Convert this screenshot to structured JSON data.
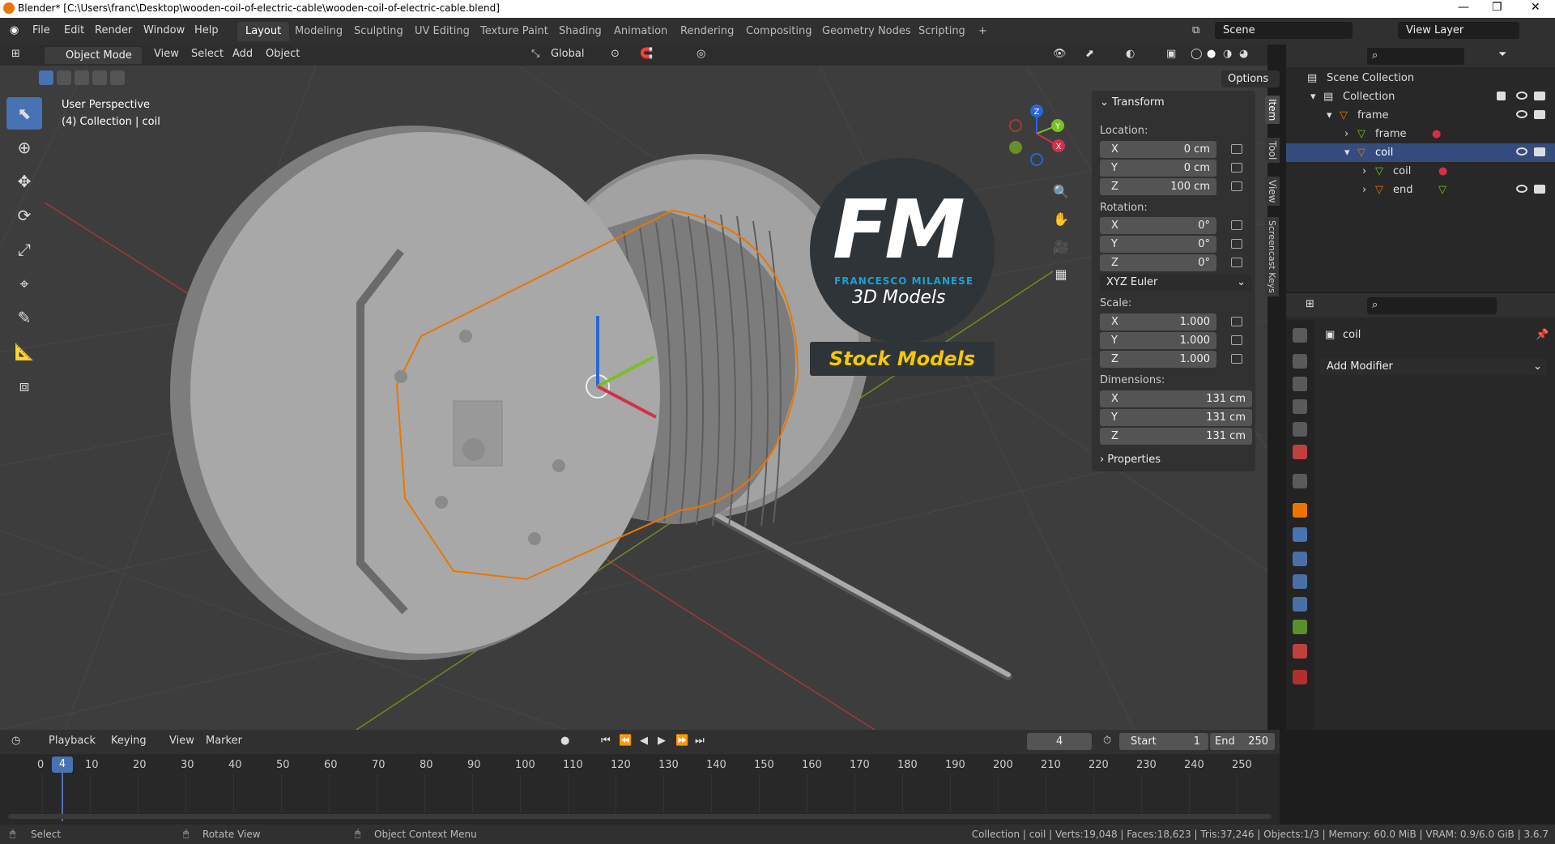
{
  "titlebar": {
    "title": "Blender* [C:\\Users\\franc\\Desktop\\wooden-coil-of-electric-cable\\wooden-coil-of-electric-cable.blend]"
  },
  "menu": {
    "file": "File",
    "edit": "Edit",
    "render": "Render",
    "window": "Window",
    "help": "Help"
  },
  "workspaces": [
    "Layout",
    "Modeling",
    "Sculpting",
    "UV Editing",
    "Texture Paint",
    "Shading",
    "Animation",
    "Rendering",
    "Compositing",
    "Geometry Nodes",
    "Scripting"
  ],
  "active_workspace": "Layout",
  "scene": {
    "label": "Scene",
    "view_layer": "View Layer"
  },
  "viewport": {
    "mode": "Object Mode",
    "menus": [
      "View",
      "Select",
      "Add",
      "Object"
    ],
    "orientation": "Global",
    "options": "Options",
    "perspective": "User Perspective",
    "collection_info": "(4) Collection | coil"
  },
  "logo": {
    "letters": "FM",
    "name": "FRANCESCO MILANESE",
    "tagline": "3D Models",
    "banner": "Stock Models"
  },
  "transform": {
    "header": "Transform",
    "location_label": "Location:",
    "location": {
      "x": "0 cm",
      "y": "0 cm",
      "z": "100 cm"
    },
    "rotation_label": "Rotation:",
    "rotation": {
      "x": "0°",
      "y": "0°",
      "z": "0°"
    },
    "rotation_mode": "XYZ Euler",
    "scale_label": "Scale:",
    "scale": {
      "x": "1.000",
      "y": "1.000",
      "z": "1.000"
    },
    "dimensions_label": "Dimensions:",
    "dimensions": {
      "x": "131 cm",
      "y": "131 cm",
      "z": "131 cm"
    },
    "properties": "Properties",
    "axis": {
      "x": "X",
      "y": "Y",
      "z": "Z"
    }
  },
  "npanel_tabs": [
    "Item",
    "Tool",
    "View",
    "Screencast Keys"
  ],
  "outliner": {
    "root": "Scene Collection",
    "items": [
      "Collection",
      "frame",
      "frame",
      "coil",
      "coil",
      "end"
    ]
  },
  "properties": {
    "object": "coil",
    "add_modifier": "Add Modifier"
  },
  "timeline": {
    "menus": [
      "Playback",
      "Keying",
      "View",
      "Marker"
    ],
    "current_frame": "4",
    "start_label": "Start",
    "start": "1",
    "end_label": "End",
    "end": "250",
    "ruler": [
      "0",
      "10",
      "20",
      "30",
      "40",
      "50",
      "60",
      "70",
      "80",
      "90",
      "100",
      "110",
      "120",
      "130",
      "140",
      "150",
      "160",
      "170",
      "180",
      "190",
      "200",
      "210",
      "220",
      "230",
      "240",
      "250"
    ]
  },
  "status": {
    "select": "Select",
    "rotate": "Rotate View",
    "context": "Object Context Menu",
    "stats": "Collection | coil | Verts:19,048 | Faces:18,623 | Tris:37,246 | Objects:1/3 | Memory: 60.0 MiB | VRAM: 0.9/6.0 GiB | 3.6.7"
  },
  "colors": {
    "accent": "#4772b3",
    "selection": "#ea7600",
    "logo_blue": "#1aa0d8",
    "banner_yellow": "#f5c800"
  }
}
